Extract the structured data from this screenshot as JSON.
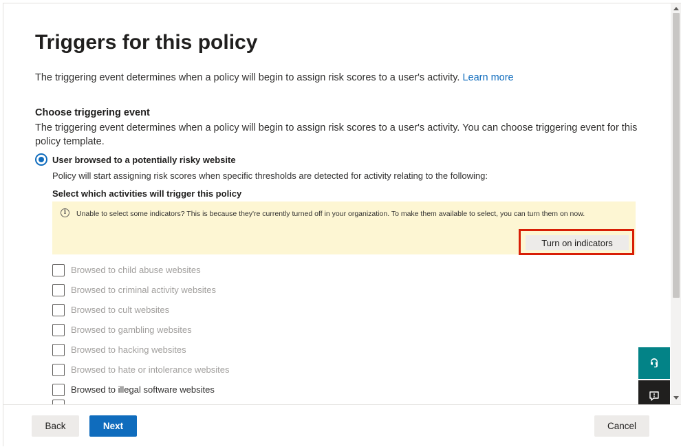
{
  "page": {
    "title": "Triggers for this policy",
    "intro_text": "The triggering event determines when a policy will begin to assign risk scores to a user's activity.",
    "learn_more": "Learn more"
  },
  "section": {
    "title": "Choose triggering event",
    "description": "The triggering event determines when a policy will begin to assign risk scores to a user's activity. You can choose triggering event for this policy template."
  },
  "trigger_option": {
    "label": "User browsed to a potentially risky website",
    "selected": true,
    "description": "Policy will start assigning risk scores when specific thresholds are detected for activity relating to the following:",
    "activities_title": "Select which activities will trigger this policy"
  },
  "notice": {
    "icon": "info-icon",
    "text": "Unable to select some indicators? This is because they're currently turned off in your organization. To make them available to select, you can turn them on now.",
    "button_label": "Turn on indicators"
  },
  "activities": [
    {
      "label": "Browsed to child abuse websites",
      "checked": false,
      "enabled": false
    },
    {
      "label": "Browsed to criminal activity websites",
      "checked": false,
      "enabled": false
    },
    {
      "label": "Browsed to cult websites",
      "checked": false,
      "enabled": false
    },
    {
      "label": "Browsed to gambling websites",
      "checked": false,
      "enabled": false
    },
    {
      "label": "Browsed to hacking websites",
      "checked": false,
      "enabled": false
    },
    {
      "label": "Browsed to hate or intolerance websites",
      "checked": false,
      "enabled": false
    },
    {
      "label": "Browsed to illegal software websites",
      "checked": false,
      "enabled": true
    }
  ],
  "footer": {
    "back": "Back",
    "next": "Next",
    "cancel": "Cancel"
  },
  "colors": {
    "accent": "#0f6cbd",
    "notice_bg": "#fdf6d3",
    "highlight": "#d81e05",
    "support_fab": "#038387"
  }
}
